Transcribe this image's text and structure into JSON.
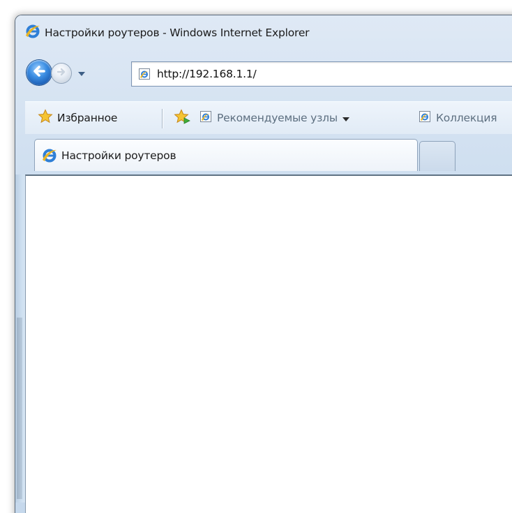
{
  "window": {
    "title": "Настройки роутеров - Windows Internet Explorer"
  },
  "nav": {
    "address": "http://192.168.1.1/"
  },
  "favorites_bar": {
    "favorites_label": "Избранное",
    "items": [
      {
        "label": "Рекомендуемые узлы",
        "icon": "ie-page-icon",
        "has_dropdown": true
      },
      {
        "label": "Коллекция",
        "icon": "ie-page-icon",
        "has_dropdown": false
      }
    ]
  },
  "tabs": [
    {
      "label": "Настройки роутеров",
      "active": true
    }
  ],
  "colors": {
    "frame": "#c8daee",
    "accent": "#1c5fb6",
    "content_bg": "#ffffff"
  }
}
